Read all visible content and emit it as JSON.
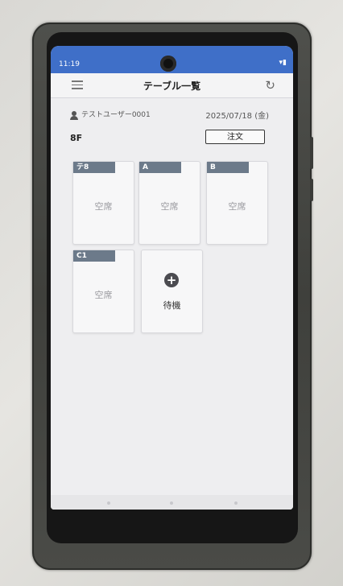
{
  "status_bar": {
    "time": "11:19",
    "icons": "▾▮"
  },
  "header": {
    "title": "テーブル一覧"
  },
  "user": {
    "name": "テストユーザー0001"
  },
  "date": "2025/07/18 (金)",
  "floor": "8F",
  "order_button": "注文",
  "tables": [
    {
      "label": "テ8",
      "status": "空席"
    },
    {
      "label": "A",
      "status": "空席"
    },
    {
      "label": "B",
      "status": "空席"
    },
    {
      "label": "C1",
      "status": "空席"
    }
  ],
  "wait_card": {
    "label": "待機"
  },
  "colors": {
    "status_bar": "#3f6fc8",
    "table_tag": "#6c7a8a"
  }
}
